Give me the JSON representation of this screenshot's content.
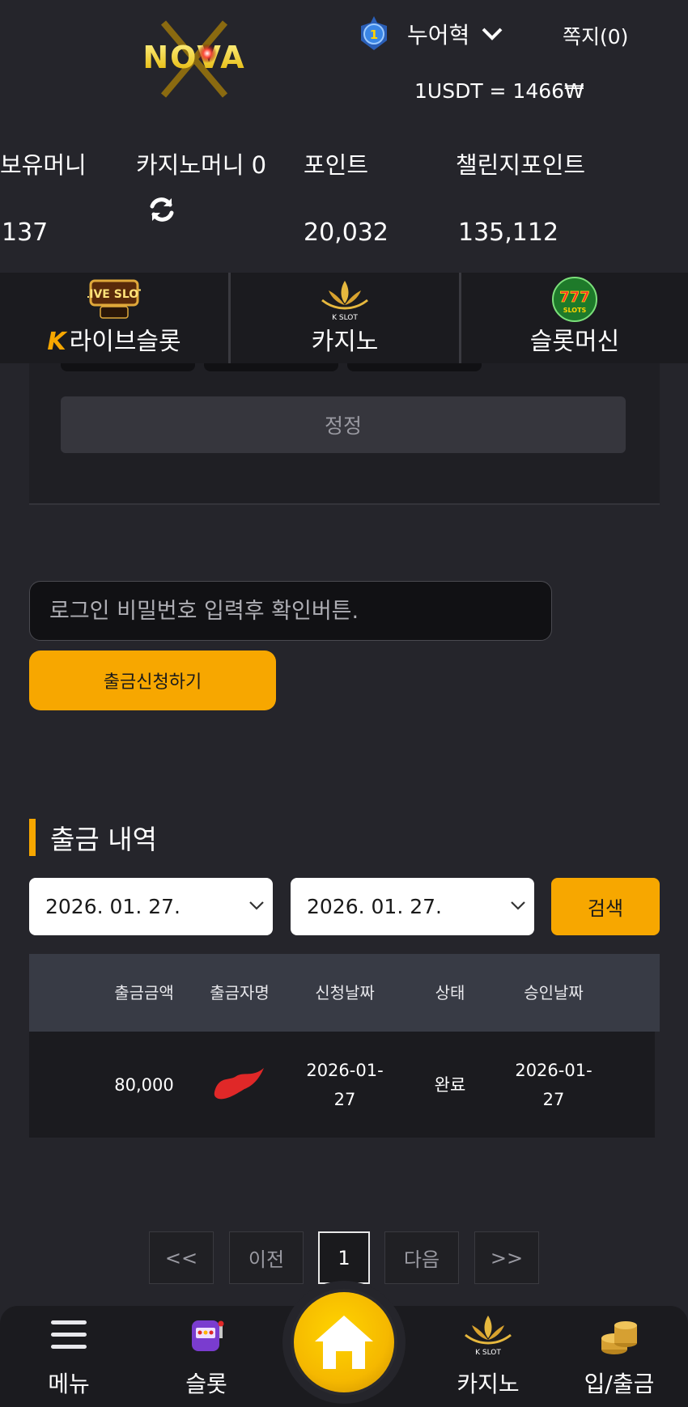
{
  "header": {
    "brand": "NOVA",
    "level": "1",
    "username": "누어혁",
    "messages": "쪽지(0)",
    "exchange_rate": "1USDT = 1466₩"
  },
  "stats": {
    "held_money_label": "보유머니",
    "held_money_value": "137",
    "casino_money_label": "카지노머니 0",
    "points_label": "포인트",
    "points_value": "20,032",
    "challenge_points_label": "챌린지포인트",
    "challenge_points_value": "135,112"
  },
  "game_tabs": {
    "live_slot": "라이브슬롯",
    "live_slot_badge": "LIVE SLOT",
    "casino": "카지노",
    "casino_badge": "K SLOT",
    "slot_machine": "슬롯머신",
    "slot_machine_badge": "SLOTS"
  },
  "form": {
    "reset_label": "정정",
    "password_placeholder": "로그인 비밀번호 입력후 확인버튼.",
    "withdraw_button": "출금신청하기"
  },
  "history": {
    "title": "출금 내역",
    "date_from": "2026. 01. 27.",
    "date_to": "2026. 01. 27.",
    "search_button": "검색",
    "columns": [
      "출금금액",
      "출금자명",
      "신청날짜",
      "상태",
      "승인날짜"
    ],
    "rows": [
      {
        "amount": "80,000",
        "name": "",
        "requested_line1": "2026-01-",
        "requested_line2": "27",
        "status": "완료",
        "approved_line1": "2026-01-",
        "approved_line2": "27"
      }
    ]
  },
  "pagination": {
    "first": "<<",
    "prev": "이전",
    "current": "1",
    "next": "다음",
    "last": ">>"
  },
  "bottom_nav": {
    "menu": "메뉴",
    "slot": "슬롯",
    "casino": "카지노",
    "deposit": "입/출금"
  },
  "colors": {
    "accent": "#f7a700",
    "background": "#25252b"
  }
}
